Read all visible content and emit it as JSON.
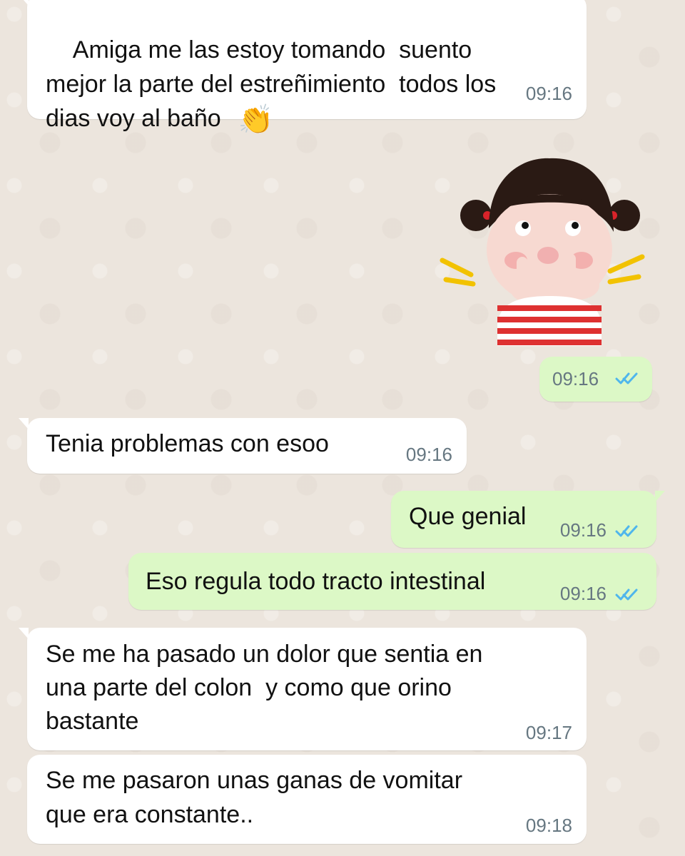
{
  "chat": {
    "messages": [
      {
        "direction": "incoming",
        "text": "Amiga me las estoy tomando  suento\nmejor la parte del estreñimiento  todos los\ndias voy al baño",
        "emoji": "👏",
        "time": "09:16"
      },
      {
        "direction": "outgoing",
        "type": "sticker",
        "sticker_name": "girl-sticker",
        "time": "09:16",
        "status_icon": "double-check-icon"
      },
      {
        "direction": "incoming",
        "text": "Tenia problemas con esoo",
        "time": "09:16"
      },
      {
        "direction": "outgoing",
        "text": "Que genial",
        "time": "09:16",
        "status_icon": "double-check-icon"
      },
      {
        "direction": "outgoing",
        "text": "Eso regula todo tracto intestinal",
        "time": "09:16",
        "status_icon": "double-check-icon"
      },
      {
        "direction": "incoming",
        "text": "Se me ha pasado un dolor que sentia en\nuna parte del colon  y como que orino\nbastante",
        "time": "09:17"
      },
      {
        "direction": "incoming",
        "text": "Se me pasaron unas ganas de vomitar\nque era constante..",
        "time": "09:18"
      }
    ]
  },
  "colors": {
    "background": "#ece5dd",
    "incoming_bubble": "#ffffff",
    "outgoing_bubble": "#dcf8c6",
    "read_ticks": "#4fb6ec",
    "timestamp": "#667781"
  }
}
